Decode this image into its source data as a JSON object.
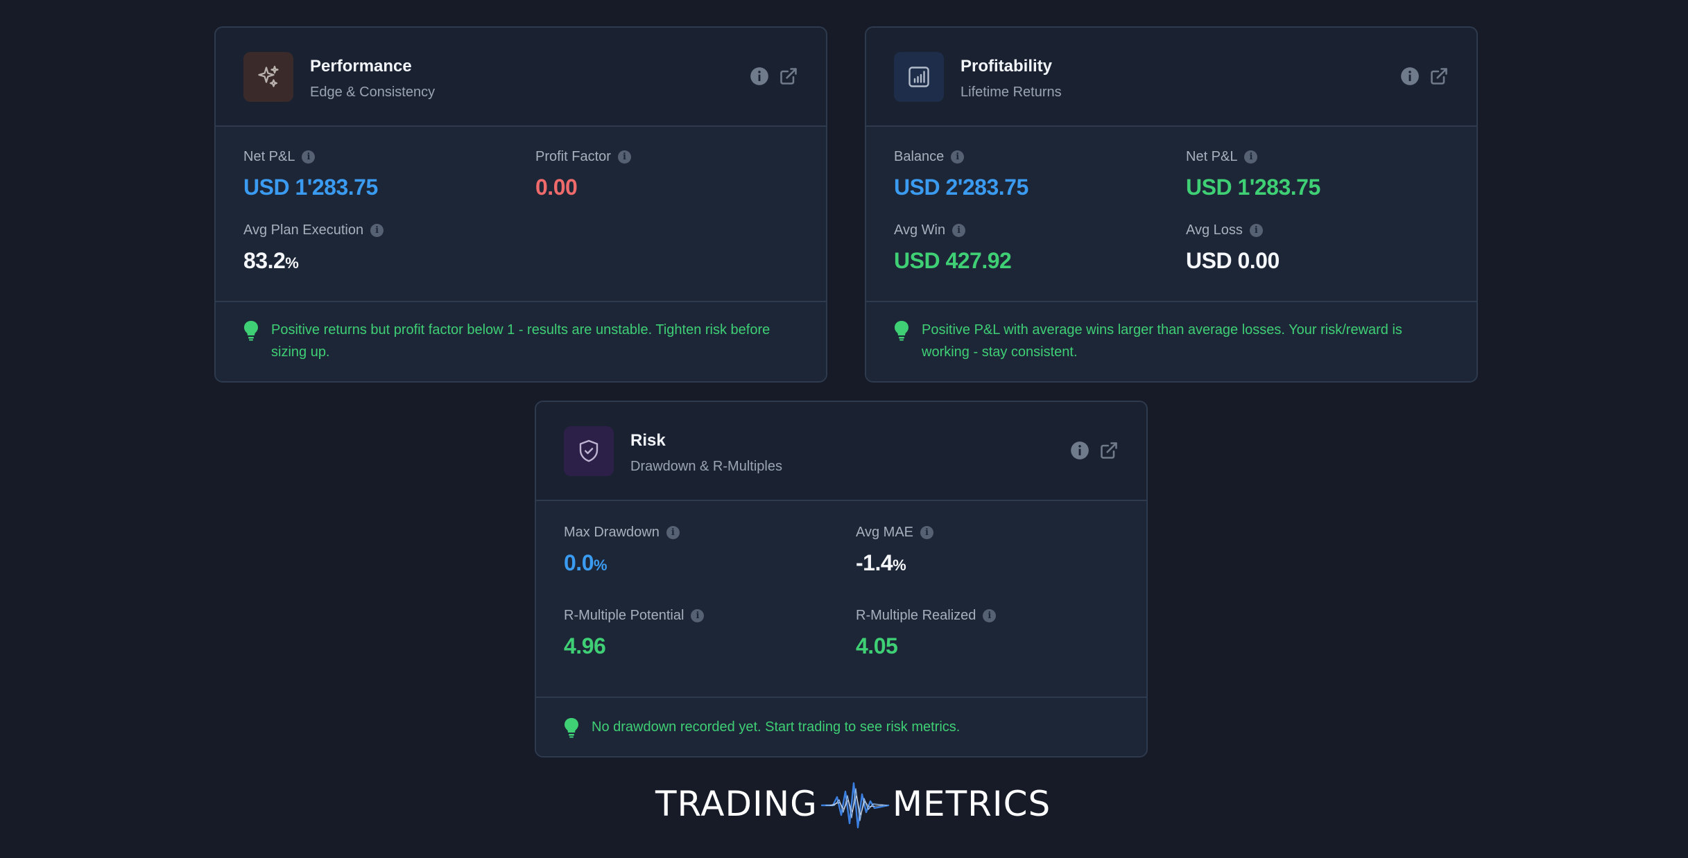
{
  "performance": {
    "title": "Performance",
    "subtitle": "Edge & Consistency",
    "icon": "sparkles-icon",
    "metrics": [
      {
        "label": "Net P&L",
        "value": "USD 1'283.75",
        "color": "#3a9bf0"
      },
      {
        "label": "Profit Factor",
        "value": "0.00",
        "color": "#ef6b6b"
      },
      {
        "label": "Avg Plan Execution",
        "value": "83.2",
        "unit": "%",
        "color": "#f5f7fa"
      }
    ],
    "tip": "Positive returns but profit factor below 1 - results are unstable. Tighten risk before sizing up."
  },
  "profitability": {
    "title": "Profitability",
    "subtitle": "Lifetime Returns",
    "icon": "bar-chart-icon",
    "metrics": [
      {
        "label": "Balance",
        "value": "USD 2'283.75",
        "color": "#3a9bf0"
      },
      {
        "label": "Net P&L",
        "value": "USD 1'283.75",
        "color": "#3fcf75"
      },
      {
        "label": "Avg Win",
        "value": "USD 427.92",
        "color": "#3fcf75"
      },
      {
        "label": "Avg Loss",
        "value": "USD 0.00",
        "color": "#f5f7fa"
      }
    ],
    "tip": "Positive P&L with average wins larger than average losses. Your risk/reward is working - stay consistent."
  },
  "risk": {
    "title": "Risk",
    "subtitle": "Drawdown & R-Multiples",
    "icon": "shield-check-icon",
    "metrics": [
      {
        "label": "Max Drawdown",
        "value": "0.0",
        "unit": "%",
        "color": "#3a9bf0"
      },
      {
        "label": "Avg MAE",
        "value": "-1.4",
        "unit": "%",
        "color": "#f5f7fa"
      },
      {
        "label": "R-Multiple Potential",
        "value": "4.96",
        "color": "#3fcf75"
      },
      {
        "label": "R-Multiple Realized",
        "value": "4.05",
        "color": "#3fcf75"
      }
    ],
    "tip": "No drawdown recorded yet. Start trading to see risk metrics."
  },
  "brand": {
    "left": "TRADING",
    "right": "METRICS"
  }
}
